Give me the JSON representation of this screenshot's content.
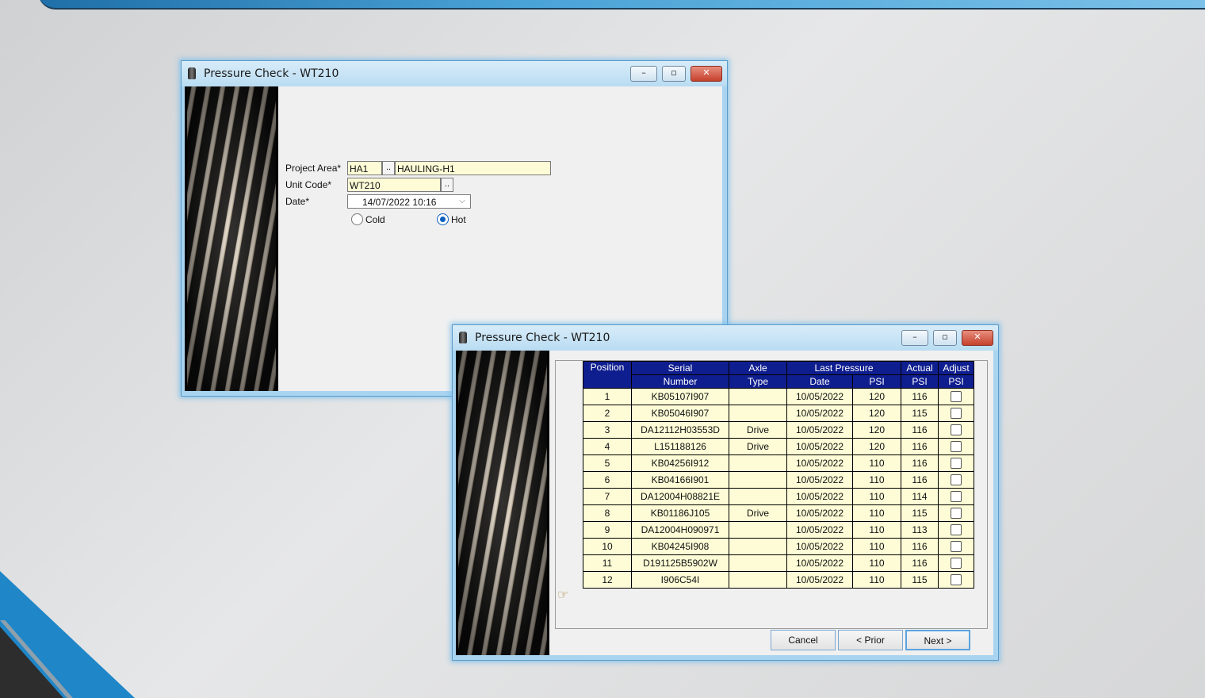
{
  "window1": {
    "title": "Pressure Check - WT210",
    "buttons": {
      "minimize": "–",
      "maximize": "▫",
      "close": "✕"
    },
    "form": {
      "project_area_label": "Project Area*",
      "project_area_code": "HA1",
      "project_area_name": "HAULING-H1",
      "unit_code_label": "Unit Code*",
      "unit_code": "WT210",
      "date_label": "Date*",
      "date_value": "14/07/2022 10:16",
      "lookup_label": "..",
      "radio_cold_label": "Cold",
      "radio_hot_label": "Hot",
      "selected": "Hot"
    }
  },
  "window2": {
    "title": "Pressure Check - WT210",
    "buttons": {
      "minimize": "–",
      "maximize": "▫",
      "close": "✕"
    },
    "grid": {
      "headers": {
        "position": "Position",
        "serial_1": "Serial",
        "serial_2": "Number",
        "axle_1": "Axle",
        "axle_2": "Type",
        "last_pressure": "Last Pressure",
        "lp_date": "Date",
        "lp_psi": "PSI",
        "actual_1": "Actual",
        "actual_2": "PSI",
        "adjust_1": "Adjust",
        "adjust_2": "PSI"
      },
      "rows": [
        {
          "position": "1",
          "serial": "KB05107I907",
          "axle": "",
          "date": "10/05/2022",
          "psi": "120",
          "actual": "116"
        },
        {
          "position": "2",
          "serial": "KB05046I907",
          "axle": "",
          "date": "10/05/2022",
          "psi": "120",
          "actual": "115"
        },
        {
          "position": "3",
          "serial": "DA12112H03553D",
          "axle": "Drive",
          "date": "10/05/2022",
          "psi": "120",
          "actual": "116"
        },
        {
          "position": "4",
          "serial": "L151188126",
          "axle": "Drive",
          "date": "10/05/2022",
          "psi": "120",
          "actual": "116"
        },
        {
          "position": "5",
          "serial": "KB04256I912",
          "axle": "",
          "date": "10/05/2022",
          "psi": "110",
          "actual": "116"
        },
        {
          "position": "6",
          "serial": "KB04166I901",
          "axle": "",
          "date": "10/05/2022",
          "psi": "110",
          "actual": "116"
        },
        {
          "position": "7",
          "serial": "DA12004H08821E",
          "axle": "",
          "date": "10/05/2022",
          "psi": "110",
          "actual": "114"
        },
        {
          "position": "8",
          "serial": "KB01186J105",
          "axle": "Drive",
          "date": "10/05/2022",
          "psi": "110",
          "actual": "115"
        },
        {
          "position": "9",
          "serial": "DA12004H090971",
          "axle": "",
          "date": "10/05/2022",
          "psi": "110",
          "actual": "113"
        },
        {
          "position": "10",
          "serial": "KB04245I908",
          "axle": "",
          "date": "10/05/2022",
          "psi": "110",
          "actual": "116"
        },
        {
          "position": "11",
          "serial": "D191125B5902W",
          "axle": "",
          "date": "10/05/2022",
          "psi": "110",
          "actual": "116"
        },
        {
          "position": "12",
          "serial": "I906C54I",
          "axle": "",
          "date": "10/05/2022",
          "psi": "110",
          "actual": "115"
        }
      ]
    },
    "buttons_bottom": {
      "cancel": "Cancel",
      "prior": "< Prior",
      "next": "Next >"
    }
  }
}
